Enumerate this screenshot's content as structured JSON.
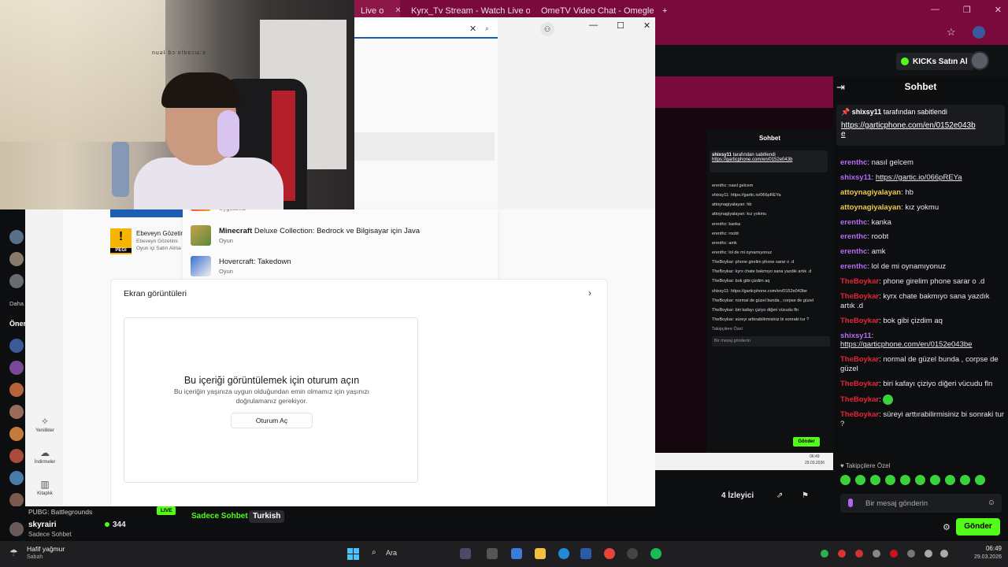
{
  "browser": {
    "tabs": [
      {
        "label": "Live o"
      },
      {
        "label": "Kyrx_Tv Stream - Watch Live on"
      },
      {
        "label": "OmeTV Video Chat - Omegle"
      }
    ],
    "new_tab": "+"
  },
  "kick": {
    "kicks_button": "KICKs Satın Al",
    "chat_title": "Sohbet",
    "pinned": {
      "user": "shixsy11",
      "text": "tarafından sabitlendi",
      "link": "https://garticphone.com/en/0152e043b",
      "link_tail": "e"
    },
    "messages": [
      {
        "user": "erenthc",
        "color": "#b56cf0",
        "text": "nasıl gelcem",
        "link": ""
      },
      {
        "user": "shixsy11",
        "color": "#b56cf0",
        "text": "",
        "link": "https://gartic.io/066pREYa"
      },
      {
        "user": "attoynagiyalayan",
        "color": "#f2c94c",
        "text": "hb",
        "link": ""
      },
      {
        "user": "attoynagiyalayan",
        "color": "#f2c94c",
        "text": "kız yokmu",
        "link": ""
      },
      {
        "user": "erenthc",
        "color": "#b56cf0",
        "text": "kanka",
        "link": ""
      },
      {
        "user": "erenthc",
        "color": "#b56cf0",
        "text": "roobt",
        "link": ""
      },
      {
        "user": "erenthc",
        "color": "#b56cf0",
        "text": "amk",
        "link": ""
      },
      {
        "user": "erenthc",
        "color": "#b56cf0",
        "text": "lol de mi oynamıyonuz",
        "link": ""
      },
      {
        "user": "TheBoykar",
        "color": "#e8233a",
        "text": "phone girelim phone sarar o .d",
        "link": ""
      },
      {
        "user": "TheBoykar",
        "color": "#e8233a",
        "text": "kyrx chate bakmıyo sana yazdık artık .d",
        "link": ""
      },
      {
        "user": "TheBoykar",
        "color": "#e8233a",
        "text": "bok gibi çizdim aq",
        "link": ""
      },
      {
        "user": "shixsy11",
        "color": "#b56cf0",
        "text": "",
        "link": "https://garticphone.com/en/0152e043be"
      },
      {
        "user": "TheBoykar",
        "color": "#e8233a",
        "text": "normal de güzel bunda , corpse de güzel",
        "link": ""
      },
      {
        "user": "TheBoykar",
        "color": "#e8233a",
        "text": "biri kafayı çiziyo diğeri vücudu fln",
        "link": ""
      },
      {
        "user": "TheBoykar",
        "color": "#e8233a",
        "text": "",
        "link": ""
      },
      {
        "user": "TheBoykar",
        "color": "#e8233a",
        "text": "süreyi arttırabilirmisiniz bi sonraki tur ?",
        "link": ""
      }
    ],
    "followers_label": "Takipçilere Özel",
    "input_placeholder": "Bir mesaj gönderin",
    "send_label": "Gönder",
    "viewers": "4 İzleyici",
    "stream": {
      "game": "PUBG: Battlegrounds",
      "live": "LIVE",
      "channel": "skyrairi",
      "subtitle": "Sadece Sohbet",
      "viewers": "344",
      "tag1": "Sadece Sohbet",
      "tag2": "Turkish"
    },
    "sidebar": {
      "more": "Daha",
      "recommended": "Öner"
    }
  },
  "nested": {
    "kicks_button": "KICKs Satın Al",
    "title": "Sohbet",
    "pinned_user": "shixsy11",
    "pinned_text": "tarafından sabitlendi",
    "pinned_link": "https://garticphone.com/en/0152e043b",
    "messages": [
      "erenthc: nasıl gelcem",
      "shixsy11: https://gartic.io/066pREYa",
      "attoynagiyalayan: hb",
      "attoynagiyalayan: kız yokmu",
      "erenthc: kanka",
      "erenthc: roobt",
      "erenthc: amk",
      "erenthc: lol de mi oynamıyonuz",
      "TheBoykar: phone girelim phone sarar o .d",
      "TheBoykar: kyrx chate bakmıyo sana yazdık artık .d",
      "TheBoykar: bok gibi çizdim aq",
      "shixsy11: https://garticphone.com/en/0152e043be",
      "TheBoykar: normal de güzel bunda , corpse de güzel",
      "TheBoykar: biri kafayı çiziyo diğeri vücudu fln",
      "TheBoykar: süreyi arttırabilirmisiniz bi sonraki tur ?"
    ],
    "followers_label": "Takipçilere Özel",
    "input_placeholder": "Bir mesaj gönderin",
    "send_label": "Gönder",
    "time": "06:49",
    "date": "29.03.2026"
  },
  "store": {
    "suggestions": [
      {
        "title": "Minecraft",
        "title_rest": " Deluxe Collection: Bedrock ve Bilgisayar için Java",
        "sub": "Oyun"
      },
      {
        "title": "",
        "title_rest": "Hovercraft: Takedown",
        "sub": "Oyun"
      }
    ],
    "partial_sub": "Uygulama",
    "pegi": {
      "label": "PEGI",
      "title": "Ebeveyn Gözetimi",
      "sub1": "Ebeveyn Gözetimi",
      "sub2": "Oyun içi Satın Alma"
    },
    "nav": [
      {
        "label": "Yenilikler"
      },
      {
        "label": "İndirmeler"
      },
      {
        "label": "Kitaplık"
      }
    ],
    "screenshots_title": "Ekran görüntüleri",
    "signin_title": "Bu içeriği görüntülemek için oturum açın",
    "signin_sub": "Bu içeriğin yaşınıza uygun olduğundan emin olmamız için yaşınızı doğrulamanız gerekiyor.",
    "signin_button": "Oturum Aç"
  },
  "cam": {
    "caption": "nuǝʇ bɔ ɐlbɐɔɯ:ɐ"
  },
  "taskbar": {
    "weather": "Hafif yağmur",
    "weather_sub": "Sabah",
    "search": "Ara",
    "time": "06:49",
    "date": "29.03.2026"
  },
  "colors": {
    "kick_green": "#53fc18",
    "browser_frame": "#7a0a3c",
    "store_accent": "#1a5fb4"
  }
}
